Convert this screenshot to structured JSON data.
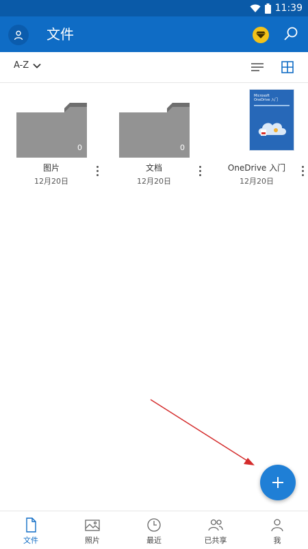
{
  "status_bar": {
    "time": "11:39"
  },
  "app_bar": {
    "title": "文件"
  },
  "sort": {
    "label": "A-Z"
  },
  "files": [
    {
      "name": "图片",
      "date": "12月20日",
      "count": "0",
      "kind": "folder"
    },
    {
      "name": "文档",
      "date": "12月20日",
      "count": "0",
      "kind": "folder"
    },
    {
      "name": "OneDrive 入门",
      "date": "12月20日",
      "kind": "pdf",
      "cover_text": [
        "Microsoft",
        "OneDrive 入门"
      ]
    }
  ],
  "tabs": [
    {
      "label": "文件",
      "icon": "file-icon",
      "active": true
    },
    {
      "label": "照片",
      "icon": "photo-icon"
    },
    {
      "label": "最近",
      "icon": "clock-icon"
    },
    {
      "label": "已共享",
      "icon": "people-icon"
    },
    {
      "label": "我",
      "icon": "person-icon"
    }
  ],
  "colors": {
    "accent": "#0f6cc5",
    "status_bar": "#0a5aa8",
    "fab": "#1f7fd6",
    "folder": "#8f8f8f"
  }
}
